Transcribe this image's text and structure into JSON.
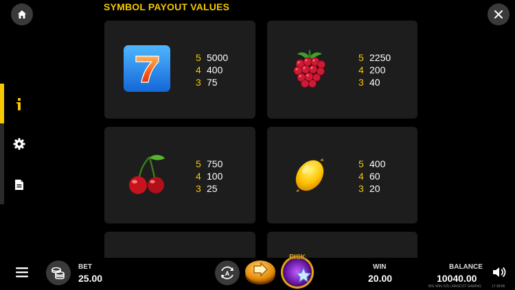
{
  "header": {
    "title": "SYMBOL PAYOUT VALUES"
  },
  "sidebar": {
    "items": [
      {
        "name": "info",
        "active": true
      },
      {
        "name": "settings",
        "active": false
      },
      {
        "name": "rules",
        "active": false
      }
    ]
  },
  "symbols": [
    {
      "name": "seven",
      "payouts": [
        {
          "count": "5",
          "value": "5000"
        },
        {
          "count": "4",
          "value": "400"
        },
        {
          "count": "3",
          "value": "75"
        }
      ]
    },
    {
      "name": "raspberry",
      "payouts": [
        {
          "count": "5",
          "value": "2250"
        },
        {
          "count": "4",
          "value": "200"
        },
        {
          "count": "3",
          "value": "40"
        }
      ]
    },
    {
      "name": "cherry",
      "payouts": [
        {
          "count": "5",
          "value": "750"
        },
        {
          "count": "4",
          "value": "100"
        },
        {
          "count": "3",
          "value": "25"
        }
      ]
    },
    {
      "name": "lemon",
      "payouts": [
        {
          "count": "5",
          "value": "400"
        },
        {
          "count": "4",
          "value": "60"
        },
        {
          "count": "3",
          "value": "20"
        }
      ]
    }
  ],
  "bottom": {
    "bet_label": "BET",
    "bet_value": "25.00",
    "auto_label": "A",
    "risk_label": "RISK",
    "win_label": "WIN",
    "win_value": "20.00",
    "balance_label": "BALANCE",
    "balance_value": "10040.00",
    "footer_info": "BIG WIN X25 | MASCOT GAMING",
    "clock": "17:38:86"
  },
  "colors": {
    "accent": "#f5c800",
    "card": "#1d1d1d",
    "background": "#000000"
  }
}
